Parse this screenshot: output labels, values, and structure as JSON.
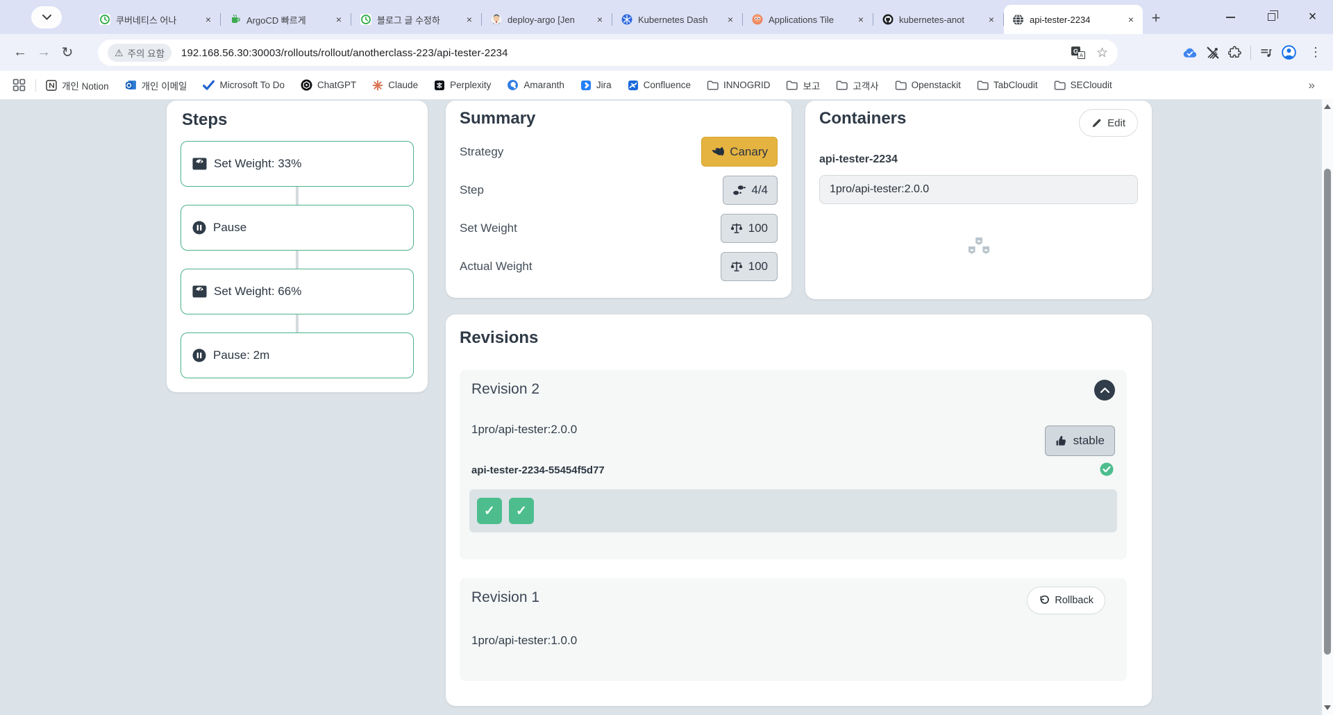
{
  "browser": {
    "tabs": [
      {
        "label": "쿠버네티스 어나",
        "icon": "clock-green"
      },
      {
        "label": "ArgoCD 빠르게",
        "icon": "mug-green"
      },
      {
        "label": "블로그 글 수정하",
        "icon": "clock-green"
      },
      {
        "label": "deploy-argo [Jen",
        "icon": "jenkins"
      },
      {
        "label": "Kubernetes Dash",
        "icon": "kubernetes"
      },
      {
        "label": "Applications Tile",
        "icon": "argo"
      },
      {
        "label": "kubernetes-anot",
        "icon": "github"
      },
      {
        "label": "api-tester-2234",
        "icon": "globe"
      }
    ],
    "address_bar": {
      "warning_text": "주의 요함",
      "url": "192.168.56.30:30003/rollouts/rollout/anotherclass-223/api-tester-2234"
    },
    "bookmarks": [
      {
        "label": "개인 Notion"
      },
      {
        "label": "개인 이메일"
      },
      {
        "label": "Microsoft To Do"
      },
      {
        "label": "ChatGPT"
      },
      {
        "label": "Claude"
      },
      {
        "label": "Perplexity"
      },
      {
        "label": "Amaranth"
      },
      {
        "label": "Jira"
      },
      {
        "label": "Confluence"
      },
      {
        "label": "INNOGRID"
      },
      {
        "label": "보고"
      },
      {
        "label": "고객사"
      },
      {
        "label": "Openstackit"
      },
      {
        "label": "TabCloudit"
      },
      {
        "label": "SECloudit"
      }
    ],
    "bookmarks_overflow": "»"
  },
  "steps_panel": {
    "title": "Steps",
    "steps": [
      {
        "label": "Set Weight: 33%",
        "icon": "weight-scale"
      },
      {
        "label": "Pause",
        "icon": "pause"
      },
      {
        "label": "Set Weight: 66%",
        "icon": "weight-scale"
      },
      {
        "label": "Pause: 2m",
        "icon": "pause"
      }
    ]
  },
  "summary_panel": {
    "title": "Summary",
    "rows": [
      {
        "label": "Strategy",
        "value": "Canary",
        "badge": "canary"
      },
      {
        "label": "Step",
        "value": "4/4",
        "badge": "steps"
      },
      {
        "label": "Set Weight",
        "value": "100",
        "badge": "balance"
      },
      {
        "label": "Actual Weight",
        "value": "100",
        "badge": "balance"
      }
    ]
  },
  "containers_panel": {
    "title": "Containers",
    "edit_label": "Edit",
    "container_name": "api-tester-2234",
    "image": "1pro/api-tester:2.0.0"
  },
  "revisions_panel": {
    "title": "Revisions",
    "revision2": {
      "name": "Revision 2",
      "image": "1pro/api-tester:2.0.0",
      "status_badge": "stable",
      "replicaset": "api-tester-2234-55454f5d77",
      "pod_count": 2
    },
    "revision1": {
      "name": "Revision 1",
      "image": "1pro/api-tester:1.0.0",
      "rollback_label": "Rollback"
    }
  },
  "colors": {
    "canary_badge": "#e5b340",
    "step_border_green": "#4ab286",
    "pod_green": "#4dbd8d",
    "page_bg": "#dce3e8",
    "tabstrip_bg": "#dce1f5"
  }
}
